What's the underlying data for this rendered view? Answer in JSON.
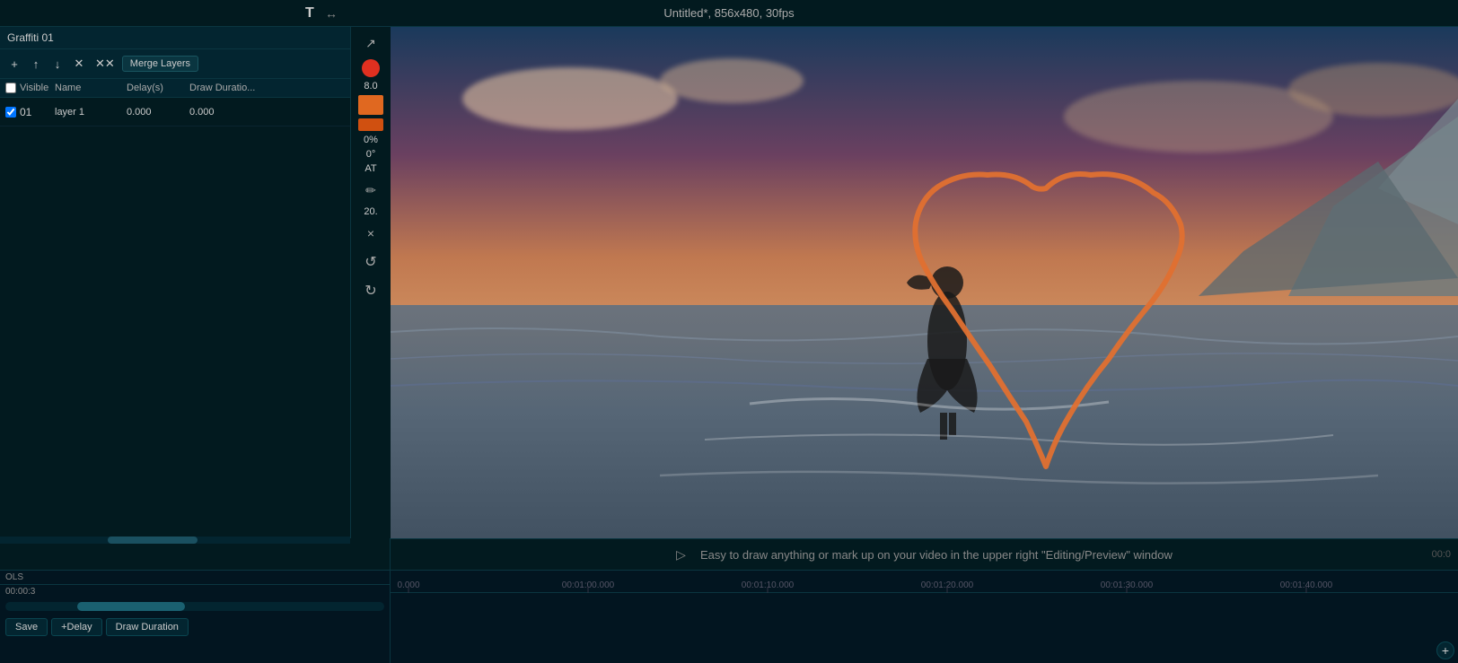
{
  "window": {
    "title": "Untitled*, 856x480, 30fps",
    "swap_icon": "↔",
    "text_icon": "T"
  },
  "panel": {
    "title": "Graffiti 01",
    "close_label": "×",
    "toolbar": {
      "add_label": "+",
      "up_label": "↑",
      "down_label": "↓",
      "delete_label": "✕",
      "delete_all_label": "✕✕",
      "merge_layers_label": "Merge Layers",
      "move_label": "✛"
    },
    "table_headers": {
      "visible_label": "Visible",
      "name_label": "Name",
      "delay_label": "Delay(s)",
      "draw_duration_label": "Draw Duratio..."
    },
    "layer": {
      "number": "01",
      "checked": true,
      "name": "layer 1",
      "delay": "0.000",
      "draw_duration": "0.000"
    }
  },
  "tools": {
    "arrow_label": "↗",
    "brush_size_label": "8.0",
    "opacity_label": "0%",
    "angle_label": "0°",
    "at_label": "AT",
    "pencil_label": "✏",
    "size2_label": "20.",
    "close_label": "×",
    "undo_label": "↺",
    "redo_label": "↻"
  },
  "message_bar": {
    "play_label": "▷",
    "message": "Easy to draw anything or mark up on your video in the upper right \"Editing/Preview\" window",
    "time": "00:0"
  },
  "timeline": {
    "label": "OLS",
    "current_time": "00:00:3",
    "add_label": "+",
    "buttons": {
      "save_label": "Save",
      "delay_label": "+Delay",
      "draw_duration_label": "Draw Duration"
    },
    "ruler_times": [
      "0.000",
      "00:01:00.000",
      "00:01:10.000",
      "00:01:20.000",
      "00:01:30.000",
      "00:01:40.000"
    ]
  },
  "colors": {
    "bg": "#021a1f",
    "panel_bg": "#032530",
    "accent": "#1a6070",
    "heart_stroke": "#e07030",
    "red_dot": "#e03020",
    "orange_swatch": "#e06820",
    "orange_swatch2": "#d05010"
  }
}
